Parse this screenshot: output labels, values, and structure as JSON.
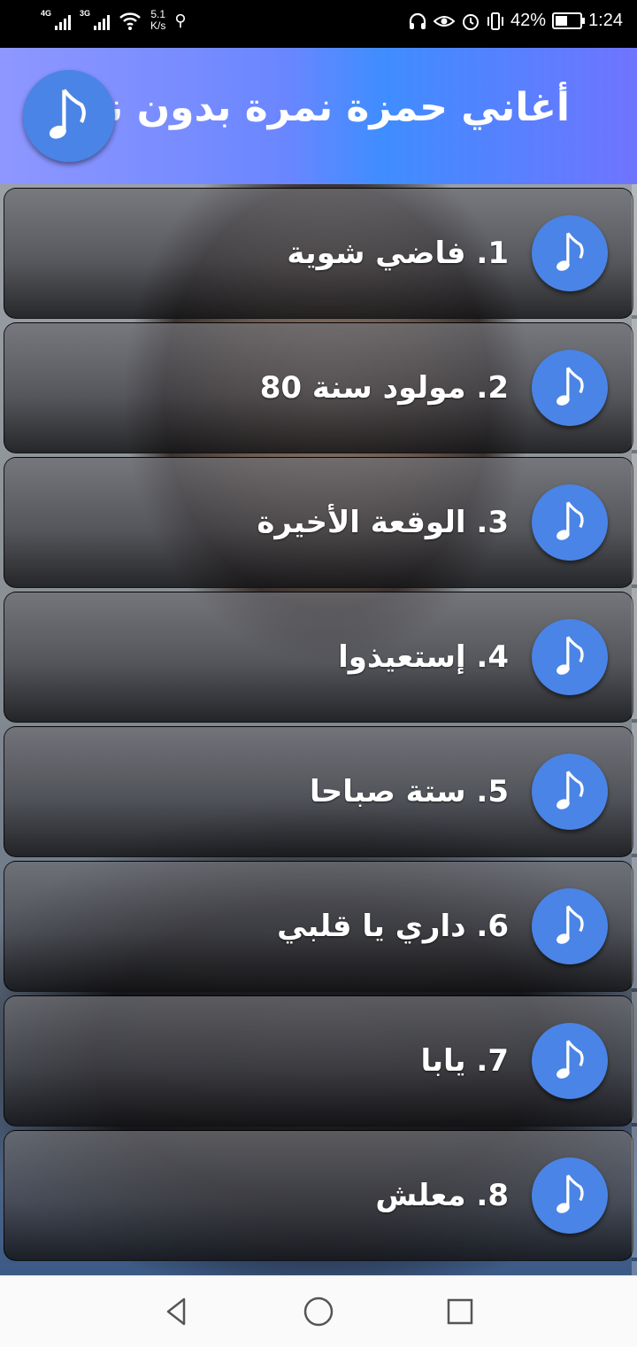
{
  "status_bar": {
    "network1": "4G",
    "network2": "3G",
    "speed_value": "5.1",
    "speed_unit": "K/s",
    "battery_percent": "42%",
    "battery_level": 0.42,
    "time": "1:24",
    "icons": [
      "signal-icon",
      "wifi-icon",
      "usb-icon",
      "headphones-icon",
      "eye-icon",
      "alarm-icon",
      "vibrate-icon",
      "battery-icon"
    ]
  },
  "header": {
    "title": "أغاني حمزة نمرة بدون نت",
    "logo_icon": "music-note-icon"
  },
  "colors": {
    "header_start": "#8f97ff",
    "header_mid": "#3f8dff",
    "icon_circle": "#4a84e6",
    "row_text": "#ffffff"
  },
  "songs": [
    {
      "label": "1. فاضي شوية"
    },
    {
      "label": "2. مولود سنة 80"
    },
    {
      "label": "3. الوقعة الأخيرة"
    },
    {
      "label": "4. إستعيذوا"
    },
    {
      "label": "5. ستة صباحا"
    },
    {
      "label": "6. داري يا قلبي"
    },
    {
      "label": "7. يابا"
    },
    {
      "label": "8. معلش"
    }
  ],
  "nav": {
    "icons": [
      "back-icon",
      "home-icon",
      "recents-icon"
    ]
  }
}
